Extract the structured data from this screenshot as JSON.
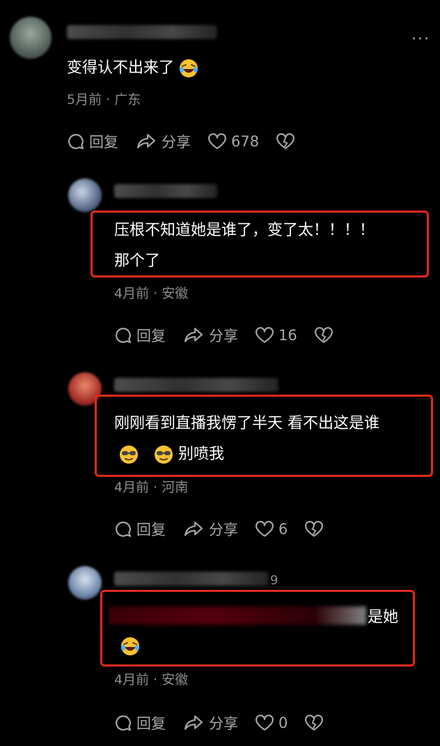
{
  "comments": [
    {
      "text": "变得认不出来了",
      "time": "5月前",
      "location": "广东",
      "reply_label": "回复",
      "share_label": "分享",
      "likes": "678"
    },
    {
      "text_line1": "压根不知道她是谁了，变了太！！！！",
      "text_line2": "那个了",
      "time": "4月前",
      "location": "安徽",
      "reply_label": "回复",
      "share_label": "分享",
      "likes": "16"
    },
    {
      "text_line1": "刚刚看到直播我愣了半天 看不出这是谁",
      "text_line2": "别喷我",
      "time": "4月前",
      "location": "河南",
      "reply_label": "回复",
      "share_label": "分享",
      "likes": "6"
    },
    {
      "text_line1": "是她",
      "name_suffix": "9",
      "time": "4月前",
      "location": "安徽",
      "reply_label": "回复",
      "share_label": "分享",
      "likes": "0"
    }
  ],
  "meta_separator": "·",
  "more_icon": "···",
  "icons": [
    "reply-bubble-icon",
    "share-arrow-icon",
    "heart-icon",
    "broken-heart-icon",
    "laughing-emoji-icon",
    "cool-emoji-icon"
  ],
  "colors": {
    "background": "#000000",
    "highlight_box": "#e02a1e",
    "meta_text": "#8d8d8d"
  }
}
